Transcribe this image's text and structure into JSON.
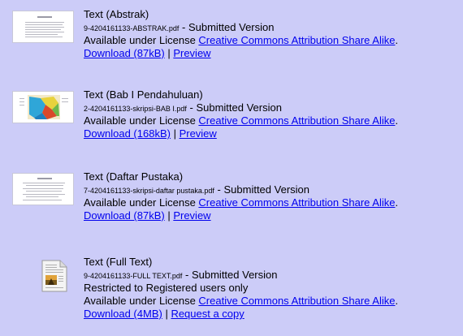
{
  "items": [
    {
      "title": "Text (Abstrak)",
      "filename": "9-4204161133-ABSTRAK.pdf",
      "version": " - Submitted Version",
      "restricted": "",
      "license_prefix": "Available under License ",
      "license_link": "Creative Commons Attribution Share Alike",
      "license_suffix": ".",
      "download": "Download (87kB)",
      "separator": " | ",
      "action": "Preview",
      "thumbnail_icon": "document-page-thumbnail"
    },
    {
      "title": "Text (Bab I Pendahuluan)",
      "filename": "2-4204161133-skripsi-BAB I.pdf",
      "version": " - Submitted Version",
      "restricted": "",
      "license_prefix": "Available under License ",
      "license_link": "Creative Commons Attribution Share Alike",
      "license_suffix": ".",
      "download": "Download (168kB)",
      "separator": " | ",
      "action": "Preview",
      "thumbnail_icon": "map-page-thumbnail"
    },
    {
      "title": "Text (Daftar Pustaka)",
      "filename": "7-4204161133-skripsi-daftar pustaka.pdf",
      "version": " - Submitted Version",
      "restricted": "",
      "license_prefix": "Available under License ",
      "license_link": "Creative Commons Attribution Share Alike",
      "license_suffix": ".",
      "download": "Download (87kB)",
      "separator": " | ",
      "action": "Preview",
      "thumbnail_icon": "document-page-thumbnail"
    },
    {
      "title": "Text (Full Text)",
      "filename": "9-4204161133-FULL TEXT.pdf",
      "version": " - Submitted Version",
      "restricted": "Restricted to Registered users only",
      "license_prefix": "Available under License ",
      "license_link": "Creative Commons Attribution Share Alike",
      "license_suffix": ".",
      "download": "Download (4MB)",
      "separator": " | ",
      "action": "Request a copy",
      "thumbnail_icon": "generic-document-icon"
    }
  ],
  "colors": {
    "background": "#ccccf8",
    "link": "#0000ee",
    "text": "#000000"
  }
}
